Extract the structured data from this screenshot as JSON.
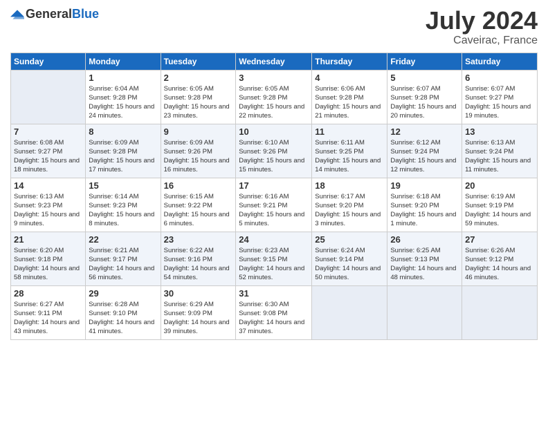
{
  "logo": {
    "text_general": "General",
    "text_blue": "Blue"
  },
  "title": {
    "month_year": "July 2024",
    "location": "Caveirac, France"
  },
  "weekdays": [
    "Sunday",
    "Monday",
    "Tuesday",
    "Wednesday",
    "Thursday",
    "Friday",
    "Saturday"
  ],
  "weeks": [
    [
      {
        "day": "",
        "sunrise": "",
        "sunset": "",
        "daylight": ""
      },
      {
        "day": "1",
        "sunrise": "Sunrise: 6:04 AM",
        "sunset": "Sunset: 9:28 PM",
        "daylight": "Daylight: 15 hours and 24 minutes."
      },
      {
        "day": "2",
        "sunrise": "Sunrise: 6:05 AM",
        "sunset": "Sunset: 9:28 PM",
        "daylight": "Daylight: 15 hours and 23 minutes."
      },
      {
        "day": "3",
        "sunrise": "Sunrise: 6:05 AM",
        "sunset": "Sunset: 9:28 PM",
        "daylight": "Daylight: 15 hours and 22 minutes."
      },
      {
        "day": "4",
        "sunrise": "Sunrise: 6:06 AM",
        "sunset": "Sunset: 9:28 PM",
        "daylight": "Daylight: 15 hours and 21 minutes."
      },
      {
        "day": "5",
        "sunrise": "Sunrise: 6:07 AM",
        "sunset": "Sunset: 9:28 PM",
        "daylight": "Daylight: 15 hours and 20 minutes."
      },
      {
        "day": "6",
        "sunrise": "Sunrise: 6:07 AM",
        "sunset": "Sunset: 9:27 PM",
        "daylight": "Daylight: 15 hours and 19 minutes."
      }
    ],
    [
      {
        "day": "7",
        "sunrise": "Sunrise: 6:08 AM",
        "sunset": "Sunset: 9:27 PM",
        "daylight": "Daylight: 15 hours and 18 minutes."
      },
      {
        "day": "8",
        "sunrise": "Sunrise: 6:09 AM",
        "sunset": "Sunset: 9:28 PM",
        "daylight": "Daylight: 15 hours and 17 minutes."
      },
      {
        "day": "9",
        "sunrise": "Sunrise: 6:09 AM",
        "sunset": "Sunset: 9:26 PM",
        "daylight": "Daylight: 15 hours and 16 minutes."
      },
      {
        "day": "10",
        "sunrise": "Sunrise: 6:10 AM",
        "sunset": "Sunset: 9:26 PM",
        "daylight": "Daylight: 15 hours and 15 minutes."
      },
      {
        "day": "11",
        "sunrise": "Sunrise: 6:11 AM",
        "sunset": "Sunset: 9:25 PM",
        "daylight": "Daylight: 15 hours and 14 minutes."
      },
      {
        "day": "12",
        "sunrise": "Sunrise: 6:12 AM",
        "sunset": "Sunset: 9:24 PM",
        "daylight": "Daylight: 15 hours and 12 minutes."
      },
      {
        "day": "13",
        "sunrise": "Sunrise: 6:13 AM",
        "sunset": "Sunset: 9:24 PM",
        "daylight": "Daylight: 15 hours and 11 minutes."
      }
    ],
    [
      {
        "day": "14",
        "sunrise": "Sunrise: 6:13 AM",
        "sunset": "Sunset: 9:23 PM",
        "daylight": "Daylight: 15 hours and 9 minutes."
      },
      {
        "day": "15",
        "sunrise": "Sunrise: 6:14 AM",
        "sunset": "Sunset: 9:23 PM",
        "daylight": "Daylight: 15 hours and 8 minutes."
      },
      {
        "day": "16",
        "sunrise": "Sunrise: 6:15 AM",
        "sunset": "Sunset: 9:22 PM",
        "daylight": "Daylight: 15 hours and 6 minutes."
      },
      {
        "day": "17",
        "sunrise": "Sunrise: 6:16 AM",
        "sunset": "Sunset: 9:21 PM",
        "daylight": "Daylight: 15 hours and 5 minutes."
      },
      {
        "day": "18",
        "sunrise": "Sunrise: 6:17 AM",
        "sunset": "Sunset: 9:20 PM",
        "daylight": "Daylight: 15 hours and 3 minutes."
      },
      {
        "day": "19",
        "sunrise": "Sunrise: 6:18 AM",
        "sunset": "Sunset: 9:20 PM",
        "daylight": "Daylight: 15 hours and 1 minute."
      },
      {
        "day": "20",
        "sunrise": "Sunrise: 6:19 AM",
        "sunset": "Sunset: 9:19 PM",
        "daylight": "Daylight: 14 hours and 59 minutes."
      }
    ],
    [
      {
        "day": "21",
        "sunrise": "Sunrise: 6:20 AM",
        "sunset": "Sunset: 9:18 PM",
        "daylight": "Daylight: 14 hours and 58 minutes."
      },
      {
        "day": "22",
        "sunrise": "Sunrise: 6:21 AM",
        "sunset": "Sunset: 9:17 PM",
        "daylight": "Daylight: 14 hours and 56 minutes."
      },
      {
        "day": "23",
        "sunrise": "Sunrise: 6:22 AM",
        "sunset": "Sunset: 9:16 PM",
        "daylight": "Daylight: 14 hours and 54 minutes."
      },
      {
        "day": "24",
        "sunrise": "Sunrise: 6:23 AM",
        "sunset": "Sunset: 9:15 PM",
        "daylight": "Daylight: 14 hours and 52 minutes."
      },
      {
        "day": "25",
        "sunrise": "Sunrise: 6:24 AM",
        "sunset": "Sunset: 9:14 PM",
        "daylight": "Daylight: 14 hours and 50 minutes."
      },
      {
        "day": "26",
        "sunrise": "Sunrise: 6:25 AM",
        "sunset": "Sunset: 9:13 PM",
        "daylight": "Daylight: 14 hours and 48 minutes."
      },
      {
        "day": "27",
        "sunrise": "Sunrise: 6:26 AM",
        "sunset": "Sunset: 9:12 PM",
        "daylight": "Daylight: 14 hours and 46 minutes."
      }
    ],
    [
      {
        "day": "28",
        "sunrise": "Sunrise: 6:27 AM",
        "sunset": "Sunset: 9:11 PM",
        "daylight": "Daylight: 14 hours and 43 minutes."
      },
      {
        "day": "29",
        "sunrise": "Sunrise: 6:28 AM",
        "sunset": "Sunset: 9:10 PM",
        "daylight": "Daylight: 14 hours and 41 minutes."
      },
      {
        "day": "30",
        "sunrise": "Sunrise: 6:29 AM",
        "sunset": "Sunset: 9:09 PM",
        "daylight": "Daylight: 14 hours and 39 minutes."
      },
      {
        "day": "31",
        "sunrise": "Sunrise: 6:30 AM",
        "sunset": "Sunset: 9:08 PM",
        "daylight": "Daylight: 14 hours and 37 minutes."
      },
      {
        "day": "",
        "sunrise": "",
        "sunset": "",
        "daylight": ""
      },
      {
        "day": "",
        "sunrise": "",
        "sunset": "",
        "daylight": ""
      },
      {
        "day": "",
        "sunrise": "",
        "sunset": "",
        "daylight": ""
      }
    ]
  ]
}
